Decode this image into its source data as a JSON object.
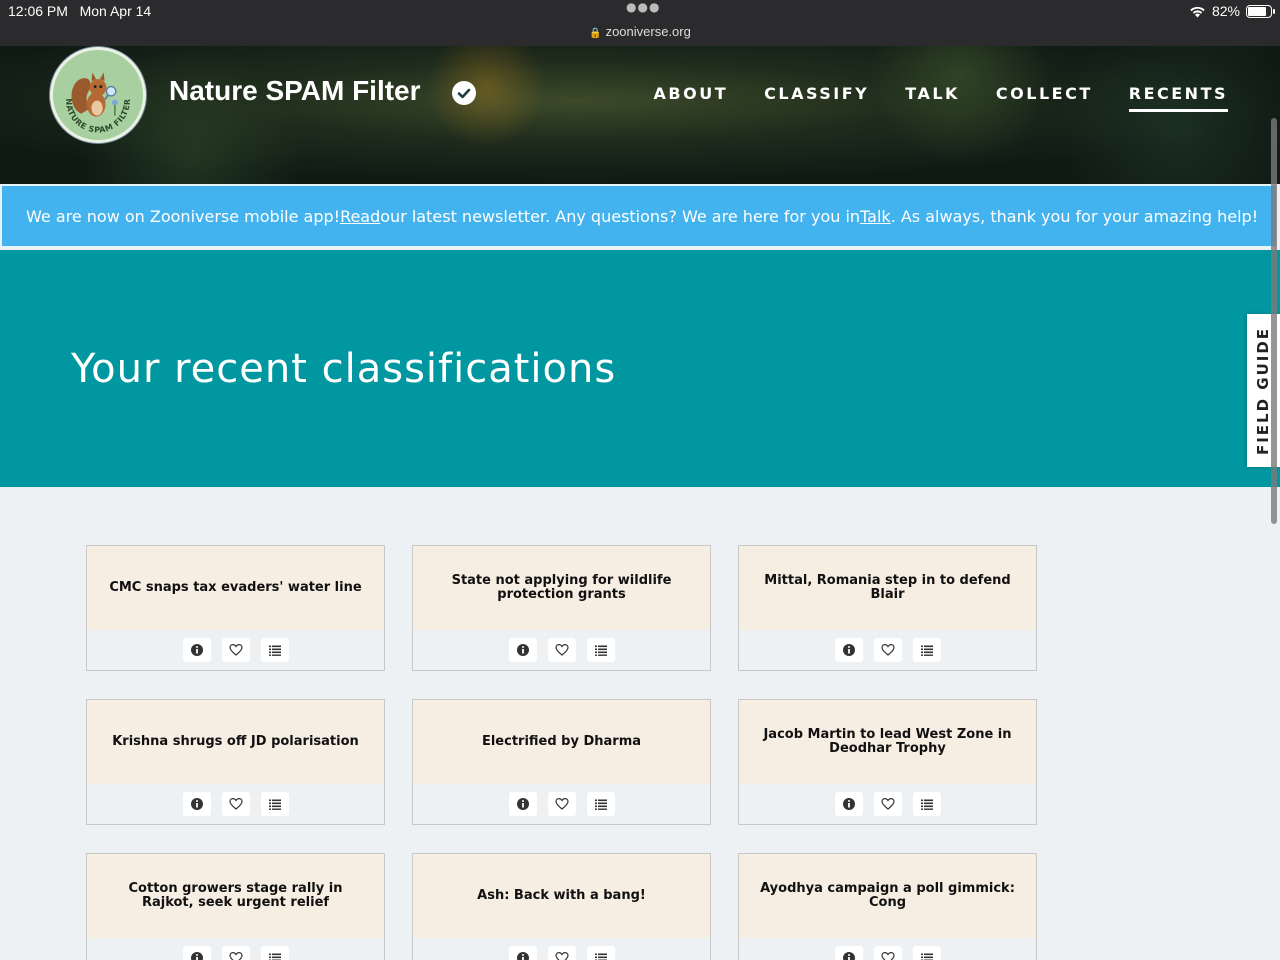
{
  "status_bar": {
    "time": "12:06 PM",
    "date": "Mon Apr 14",
    "url": "zooniverse.org",
    "battery": "82%",
    "battery_level": 0.82
  },
  "header": {
    "logo_text": "NATURE SPAM FILTER",
    "project_title": "Nature SPAM Filter",
    "nav": [
      {
        "label": "ABOUT"
      },
      {
        "label": "CLASSIFY"
      },
      {
        "label": "TALK"
      },
      {
        "label": "COLLECT"
      },
      {
        "label": "RECENTS",
        "active": true
      }
    ]
  },
  "banner": {
    "text1": "We are now on Zooniverse mobile app! ",
    "link1": "Read",
    "text2": " our latest newsletter. Any questions? We are here for you in ",
    "link2": "Talk",
    "text3": ". As always, thank you for your amazing help!"
  },
  "hero": {
    "title": "Your recent classifications"
  },
  "field_guide": {
    "label": "FIELD GUIDE"
  },
  "cards": [
    {
      "title": "CMC snaps tax evaders' water line"
    },
    {
      "title": "State not applying for wildlife protection grants"
    },
    {
      "title": "Mittal, Romania step in to defend Blair"
    },
    {
      "title": "Krishna shrugs off JD polarisation"
    },
    {
      "title": "Electrified by Dharma"
    },
    {
      "title": "Jacob Martin to lead West Zone in Deodhar Trophy"
    },
    {
      "title": "Cotton growers stage rally in Rajkot, seek urgent relief"
    },
    {
      "title": "Ash: Back with a bang!"
    },
    {
      "title": "Ayodhya campaign a poll gimmick: Cong"
    }
  ],
  "icons": {
    "info": "info-icon",
    "favorite": "heart-icon",
    "collect": "list-icon"
  },
  "colors": {
    "banner": "#43b3ef",
    "hero": "#0097a0",
    "card_top": "#f6eee2",
    "page_bg": "#eef1f4"
  }
}
